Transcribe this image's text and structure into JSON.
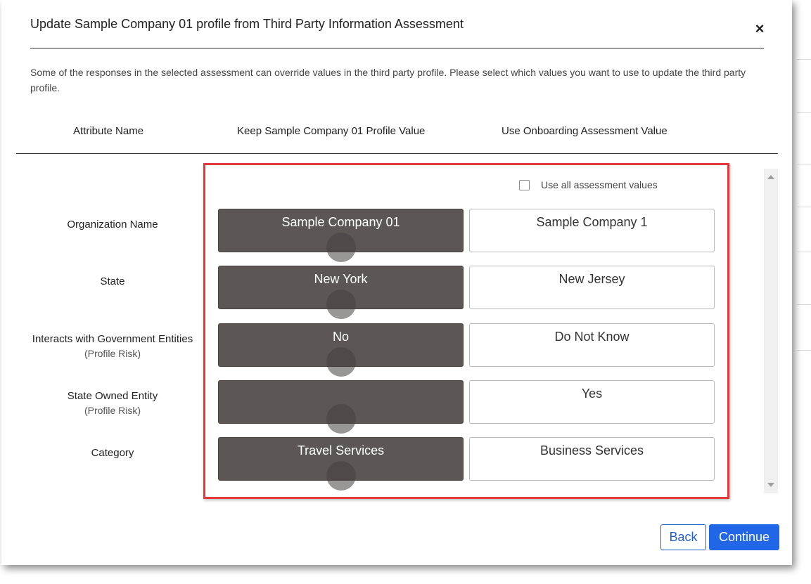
{
  "dialog": {
    "title": "Update Sample Company 01 profile from Third Party Information Assessment",
    "close_symbol": "×",
    "intro": "Some of the responses in the selected assessment can override values in the third party profile. Please select which values you want to use to update the third party profile."
  },
  "columns": {
    "attribute": "Attribute Name",
    "keep": "Keep Sample Company 01 Profile Value",
    "use": "Use Onboarding Assessment Value"
  },
  "use_all": {
    "label": "Use all assessment values",
    "checked": false
  },
  "rows": [
    {
      "label": "Organization Name",
      "sublabel": "",
      "keep": "Sample Company 01",
      "use": "Sample Company 1"
    },
    {
      "label": "State",
      "sublabel": "",
      "keep": "New York",
      "use": "New Jersey"
    },
    {
      "label": "Interacts with Government Entities",
      "sublabel": "(Profile Risk)",
      "keep": "No",
      "use": "Do Not Know"
    },
    {
      "label": "State Owned Entity",
      "sublabel": "(Profile Risk)",
      "keep": "",
      "use": "Yes"
    },
    {
      "label": "Category",
      "sublabel": "",
      "keep": "Travel Services",
      "use": "Business Services"
    }
  ],
  "footer": {
    "back": "Back",
    "continue": "Continue"
  },
  "colors": {
    "selected_option": "#5c5654",
    "highlight_border": "#e5383b",
    "primary_button": "#2266e8"
  }
}
